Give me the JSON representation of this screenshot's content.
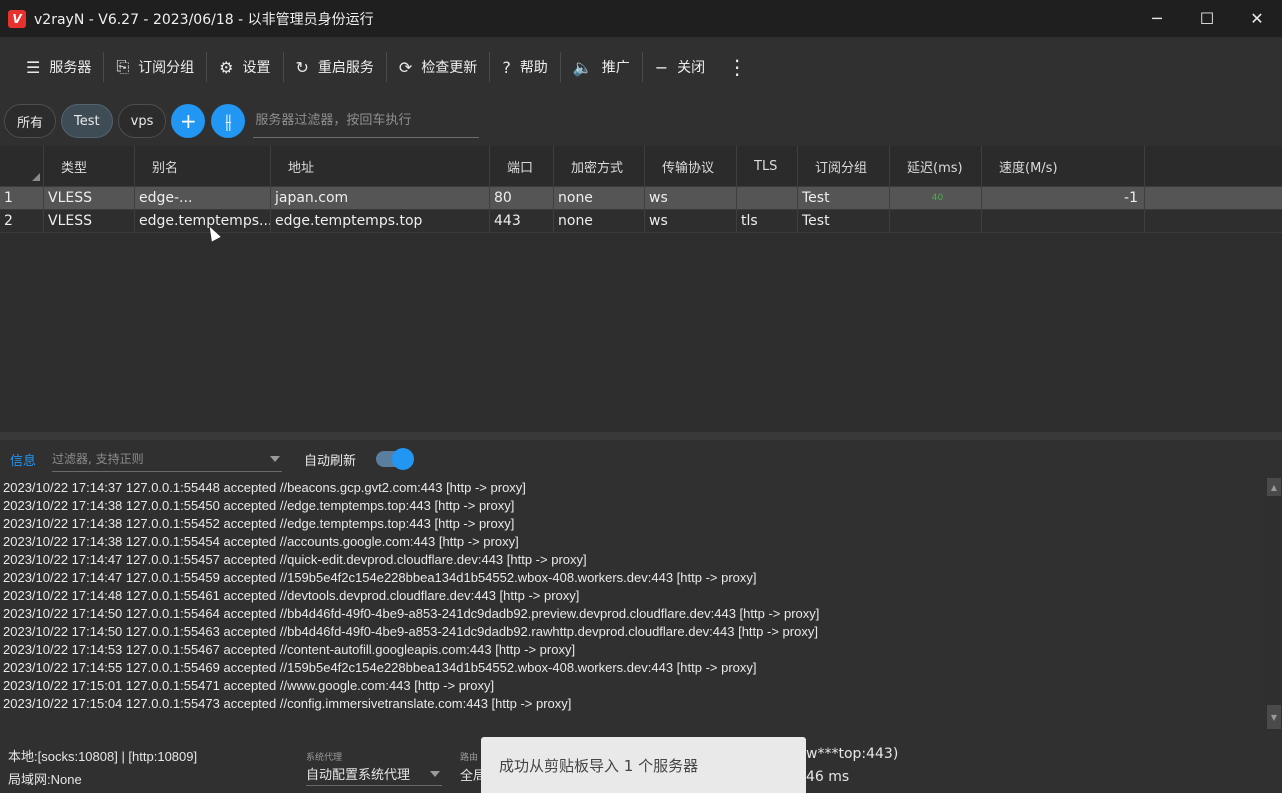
{
  "window": {
    "title": "v2rayN - V6.27 - 2023/06/18 - 以非管理员身份运行",
    "logo_text": "V",
    "controls": {
      "minimize": "─",
      "maximize": "☐",
      "close": "✕"
    }
  },
  "toolbar": {
    "items": [
      {
        "label": "服务器",
        "icon": "server-icon",
        "glyph": "☰"
      },
      {
        "label": "订阅分组",
        "icon": "subscription-icon",
        "glyph": "⎘"
      },
      {
        "label": "设置",
        "icon": "gear-icon",
        "glyph": "⚙"
      },
      {
        "label": "重启服务",
        "icon": "restart-icon",
        "glyph": "↻"
      },
      {
        "label": "检查更新",
        "icon": "update-icon",
        "glyph": "⟳"
      },
      {
        "label": "帮助",
        "icon": "help-icon",
        "glyph": "?"
      },
      {
        "label": "推广",
        "icon": "speaker-icon",
        "glyph": "🔈"
      },
      {
        "label": "关闭",
        "icon": "minus-icon",
        "glyph": "−"
      }
    ],
    "more_glyph": "⋮"
  },
  "filters": {
    "chips": [
      "所有",
      "Test",
      "vps"
    ],
    "selected": "Test",
    "add_glyph": "+",
    "split_glyph": "⫲",
    "search_placeholder": "服务器过滤器，按回车执行"
  },
  "grid": {
    "columns": [
      "",
      "类型",
      "别名",
      "地址",
      "端口",
      "加密方式",
      "传输协议",
      "TLS",
      "订阅分组",
      "延迟(ms)",
      "速度(M/s)"
    ],
    "rows": [
      {
        "idx": "1",
        "type": "VLESS",
        "alias": "edge-...",
        "address": "japan.com",
        "port": "80",
        "encryption": "none",
        "network": "ws",
        "tls": "",
        "subscription": "Test",
        "delay": "40",
        "speed": "-1"
      },
      {
        "idx": "2",
        "type": "VLESS",
        "alias": "edge.temptemps....",
        "address": "edge.temptemps.top",
        "port": "443",
        "encryption": "none",
        "network": "ws",
        "tls": "tls",
        "subscription": "Test",
        "delay": "",
        "speed": ""
      }
    ]
  },
  "log": {
    "tab_label": "信息",
    "filter_placeholder": "过滤器, 支持正则",
    "auto_refresh_label": "自动刷新",
    "auto_refresh": true,
    "lines": [
      "2023/10/22 17:14:37 127.0.0.1:55448 accepted //beacons.gcp.gvt2.com:443 [http -> proxy]",
      "2023/10/22 17:14:38 127.0.0.1:55450 accepted //edge.temptemps.top:443 [http -> proxy]",
      "2023/10/22 17:14:38 127.0.0.1:55452 accepted //edge.temptemps.top:443 [http -> proxy]",
      "2023/10/22 17:14:38 127.0.0.1:55454 accepted //accounts.google.com:443 [http -> proxy]",
      "2023/10/22 17:14:47 127.0.0.1:55457 accepted //quick-edit.devprod.cloudflare.dev:443 [http -> proxy]",
      "2023/10/22 17:14:47 127.0.0.1:55459 accepted //159b5e4f2c154e228bbea134d1b54552.wbox-408.workers.dev:443 [http -> proxy]",
      "2023/10/22 17:14:48 127.0.0.1:55461 accepted //devtools.devprod.cloudflare.dev:443 [http -> proxy]",
      "2023/10/22 17:14:50 127.0.0.1:55464 accepted //bb4d46fd-49f0-4be9-a853-241dc9dadb92.preview.devprod.cloudflare.dev:443 [http -> proxy]",
      "2023/10/22 17:14:50 127.0.0.1:55463 accepted //bb4d46fd-49f0-4be9-a853-241dc9dadb92.rawhttp.devprod.cloudflare.dev:443 [http -> proxy]",
      "2023/10/22 17:14:53 127.0.0.1:55467 accepted //content-autofill.googleapis.com:443 [http -> proxy]",
      "2023/10/22 17:14:55 127.0.0.1:55469 accepted //159b5e4f2c154e228bbea134d1b54552.wbox-408.workers.dev:443 [http -> proxy]",
      "2023/10/22 17:15:01 127.0.0.1:55471 accepted //www.google.com:443 [http -> proxy]",
      "2023/10/22 17:15:04 127.0.0.1:55473 accepted //config.immersivetranslate.com:443 [http -> proxy]"
    ]
  },
  "status": {
    "local": "本地:[socks:10808] | [http:10809]",
    "lan": "局域网:None",
    "system_proxy_label": "系统代理",
    "system_proxy_value": "自动配置系统代理",
    "routing_label": "路由",
    "routing_value": "全局",
    "server_info": "w***top:443)",
    "latency": "46 ms"
  },
  "toast": {
    "message": "成功从剪贴板导入 1 个服务器"
  }
}
